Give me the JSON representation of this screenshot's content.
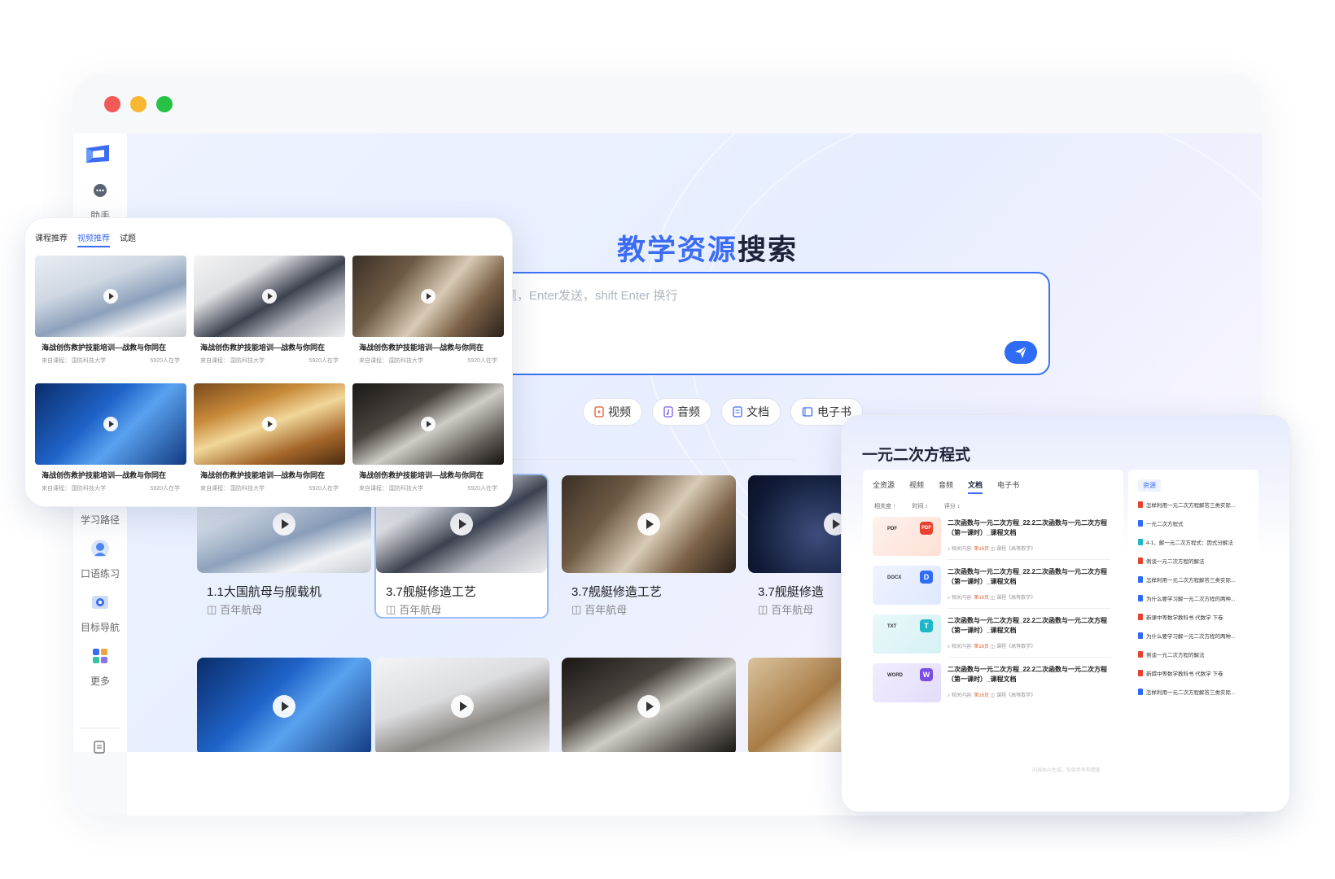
{
  "sidebar": {
    "items": [
      {
        "label": "助手",
        "icon": "chat-icon"
      },
      {
        "label": "学习路径",
        "icon": "path-icon"
      },
      {
        "label": "口语练习",
        "icon": "speech-icon"
      },
      {
        "label": "目标导航",
        "icon": "target-icon"
      },
      {
        "label": "更多",
        "icon": "grid-icon"
      }
    ]
  },
  "main": {
    "title_part1": "教学资源",
    "title_part2": "搜索",
    "search_placeholder": "题，Enter发送，shift Enter 换行",
    "chips": [
      {
        "label": "视频",
        "icon": "video-icon"
      },
      {
        "label": "音频",
        "icon": "audio-icon"
      },
      {
        "label": "文档",
        "icon": "doc-icon"
      },
      {
        "label": "电子书",
        "icon": "book-icon"
      }
    ],
    "tab_fragment": "书",
    "videos": [
      {
        "title": "1.1大国航母与舰载机",
        "course": "百年航母"
      },
      {
        "title": "3.7舰艇修造工艺",
        "course": "百年航母"
      },
      {
        "title": "3.7舰艇修造工艺",
        "course": "百年航母"
      },
      {
        "title": "3.7舰艇修造",
        "course": "百年航母"
      }
    ]
  },
  "left_card": {
    "tabs": [
      "课程推荐",
      "视频推荐",
      "试题"
    ],
    "active_tab": "视频推荐",
    "video_title": "海战创伤救护技能培训—战救与你同在",
    "source": "来自课程：  国防科技大学",
    "count": "5920人在学"
  },
  "right_card": {
    "title": "一元二次方程式",
    "tabs": [
      "全资源",
      "视频",
      "音频",
      "文档",
      "电子书"
    ],
    "active_tab": "文档",
    "sort": [
      "相关度 ↑",
      "时间 ↕",
      "评分 ↕"
    ],
    "docs": [
      {
        "kind": "PDF",
        "badge": "PDF"
      },
      {
        "kind": "DOCX",
        "badge": "D"
      },
      {
        "kind": "TXT",
        "badge": "T"
      },
      {
        "kind": "WORD",
        "badge": "W"
      }
    ],
    "doc_title": "二次函数与一元二次方程_22.2二次函数与一元二次方程（第一课时）_课程文档",
    "doc_meta_prefix": "⌕ 相关内容:",
    "doc_meta_page": "第16页",
    "doc_meta_course": "◫ 课程《高等数学》",
    "resources_label": "资源",
    "resources": [
      "怎样利用一元二次方程解答三类实际...",
      "一元二次方程式",
      "4-1、解一元二次方程式：因式分解法",
      "例谈一元二次方程的解法",
      "怎样利用一元二次方程解答三类实际...",
      "为什么要学习解一元二次方程的两种...",
      "新课中等数学教科书 代数学 下卷",
      "为什么要学习解一元二次方程的两种...",
      "例谈一元二次方程的解法",
      "新撰中等数学教科书 代数学 下卷",
      "怎样利用一元二次方程解答三类实际..."
    ],
    "footer": "内容由AI生成，仅供参考和借鉴"
  },
  "colors": {
    "accent": "#3b6cf3",
    "red": "#f35a55",
    "yellow": "#f8b731",
    "green": "#26c245"
  }
}
